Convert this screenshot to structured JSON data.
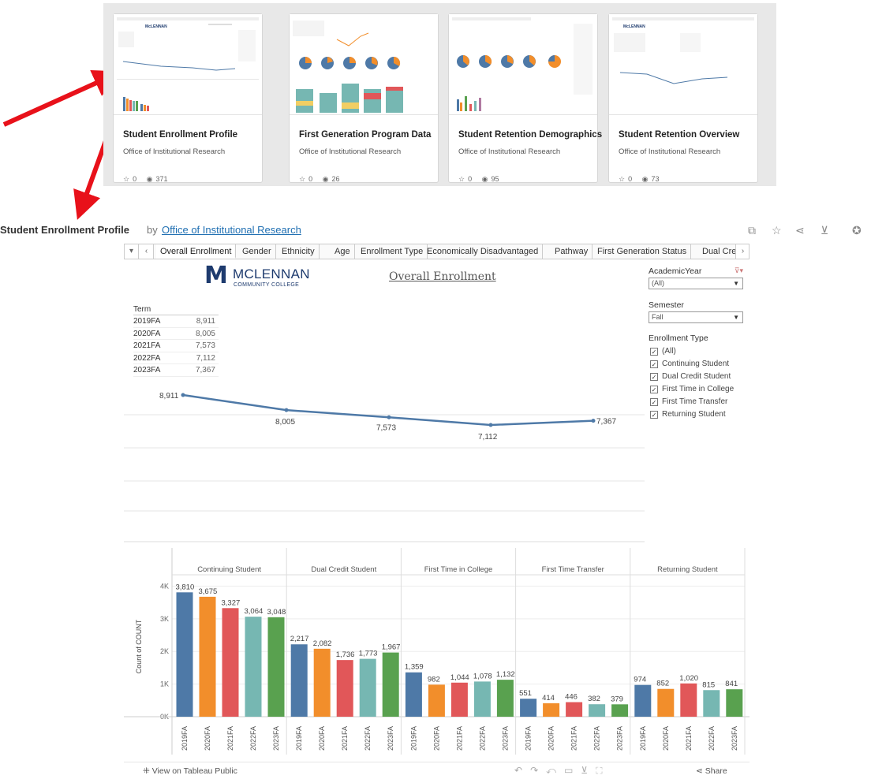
{
  "gallery": {
    "cards": [
      {
        "title": "Student Enrollment Profile",
        "owner": "Office of Institutional Research",
        "favorites": "0",
        "views": "371"
      },
      {
        "title": "First Generation Program Data",
        "owner": "Office of Institutional Research",
        "favorites": "0",
        "views": "26"
      },
      {
        "title": "Student Retention Demographics",
        "owner": "Office of Institutional Research",
        "favorites": "0",
        "views": "95"
      },
      {
        "title": "Student Retention Overview",
        "owner": "Office of Institutional Research",
        "favorites": "0",
        "views": "73"
      }
    ]
  },
  "header": {
    "title": "Student Enrollment Profile",
    "by": "by",
    "owner": "Office of Institutional Research",
    "icons": [
      "copy-icon",
      "star-icon",
      "share-icon",
      "download-icon",
      "badge-icon"
    ]
  },
  "tabs": {
    "items": [
      "Overall Enrollment",
      "Gender",
      "Ethnicity",
      "Age",
      "Enrollment Type",
      "Economically Disadvantaged",
      "Pathway",
      "First Generation Status",
      "Dual Cred"
    ],
    "active": "Overall Enrollment"
  },
  "dashboard": {
    "logo_name": "MCLENNAN",
    "logo_sub": "COMMUNITY COLLEGE",
    "title": "Overall Enrollment",
    "term_table": {
      "header": "Term",
      "rows": [
        {
          "term": "2019FA",
          "value": "8,911"
        },
        {
          "term": "2020FA",
          "value": "8,005"
        },
        {
          "term": "2021FA",
          "value": "7,573"
        },
        {
          "term": "2022FA",
          "value": "7,112"
        },
        {
          "term": "2023FA",
          "value": "7,367"
        }
      ]
    },
    "filters": {
      "academic_year_label": "AcademicYear",
      "academic_year_value": "(All)",
      "semester_label": "Semester",
      "semester_value": "Fall",
      "enrollment_type_label": "Enrollment Type",
      "enrollment_type_options": [
        "(All)",
        "Continuing Student",
        "Dual Credit Student",
        "First Time in College",
        "First Time Transfer",
        "Returning Student"
      ]
    }
  },
  "footer": {
    "view_label": "View on Tableau Public",
    "share_label": "Share"
  },
  "colors": {
    "blue": "#4e79a7",
    "orange": "#f28e2b",
    "red": "#e15759",
    "teal": "#76b7b2",
    "green": "#59a14f",
    "line": "#4e79a7"
  },
  "chart_data": [
    {
      "type": "line",
      "x": [
        "2019FA",
        "2020FA",
        "2021FA",
        "2022FA",
        "2023FA"
      ],
      "values": [
        8911,
        8005,
        7573,
        7112,
        7367
      ],
      "labels": [
        "8,911",
        "8,005",
        "7,573",
        "7,112",
        "7,367"
      ]
    },
    {
      "type": "bar",
      "ylabel": "Count of COUNT",
      "yticks": [
        "0K",
        "1K",
        "2K",
        "3K",
        "4K"
      ],
      "ylim": [
        0,
        4300
      ],
      "categories": [
        "2019FA",
        "2020FA",
        "2021FA",
        "2022FA",
        "2023FA"
      ],
      "panels": [
        {
          "name": "Continuing Student",
          "values": [
            3810,
            3675,
            3327,
            3064,
            3048
          ],
          "labels": [
            "3,810",
            "3,675",
            "3,327",
            "3,064",
            "3,048"
          ]
        },
        {
          "name": "Dual Credit Student",
          "values": [
            2217,
            2082,
            1736,
            1773,
            1967
          ],
          "labels": [
            "2,217",
            "2,082",
            "1,736",
            "1,773",
            "1,967"
          ]
        },
        {
          "name": "First Time in College",
          "values": [
            1359,
            982,
            1044,
            1078,
            1132
          ],
          "labels": [
            "1,359",
            "982",
            "1,044",
            "1,078",
            "1,132"
          ]
        },
        {
          "name": "First Time Transfer",
          "values": [
            551,
            414,
            446,
            382,
            379
          ],
          "labels": [
            "551",
            "414",
            "446",
            "382",
            "379"
          ]
        },
        {
          "name": "Returning Student",
          "values": [
            974,
            852,
            1020,
            815,
            841
          ],
          "labels": [
            "974",
            "852",
            "1,020",
            "815",
            "841"
          ]
        }
      ]
    }
  ]
}
